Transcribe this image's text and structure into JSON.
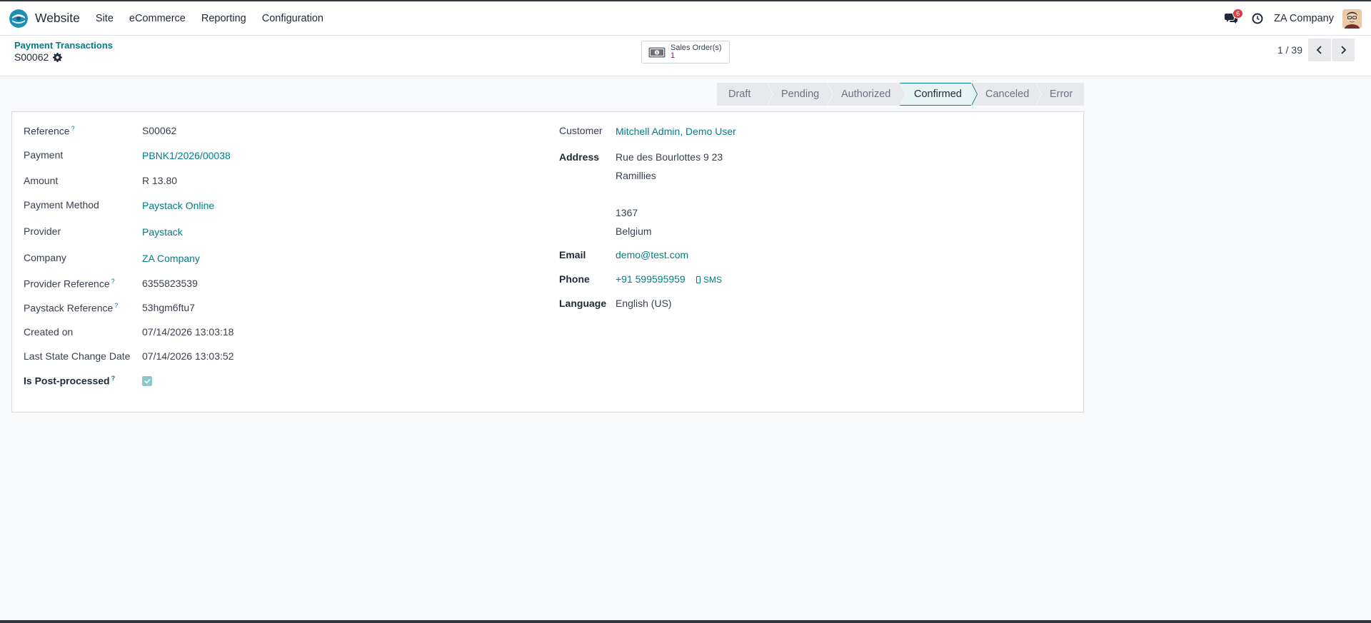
{
  "navbar": {
    "app_name": "Website",
    "menu": [
      "Site",
      "eCommerce",
      "Reporting",
      "Configuration"
    ],
    "message_count": "6",
    "company": "ZA Company"
  },
  "control_panel": {
    "breadcrumb_parent": "Payment Transactions",
    "record_name": "S00062",
    "smart_button": {
      "label": "Sales Order(s)",
      "value": "1"
    },
    "pager": "1 / 39"
  },
  "statusbar": {
    "stages": [
      "Draft",
      "Pending",
      "Authorized",
      "Confirmed",
      "Canceled",
      "Error"
    ],
    "active": "Confirmed"
  },
  "form": {
    "left": {
      "reference": {
        "label": "Reference",
        "value": "S00062"
      },
      "payment": {
        "label": "Payment",
        "value": "PBNK1/2026/00038"
      },
      "amount": {
        "label": "Amount",
        "value": "R 13.80"
      },
      "payment_method": {
        "label": "Payment Method",
        "value": "Paystack Online"
      },
      "provider": {
        "label": "Provider",
        "value": "Paystack"
      },
      "company": {
        "label": "Company",
        "value": "ZA Company"
      },
      "provider_reference": {
        "label": "Provider Reference",
        "value": "6355823539"
      },
      "paystack_reference": {
        "label": "Paystack Reference",
        "value": "53hgm6ftu7"
      },
      "created_on": {
        "label": "Created on",
        "value": "07/14/2026 13:03:18"
      },
      "last_state_change": {
        "label": "Last State Change Date",
        "value": "07/14/2026 13:03:52"
      },
      "is_post_processed": {
        "label": "Is Post-processed",
        "checked": true
      }
    },
    "right": {
      "customer": {
        "label": "Customer",
        "value": "Mitchell Admin, Demo User"
      },
      "address": {
        "label": "Address",
        "street": "Rue des Bourlottes 9 23",
        "city": "Ramillies",
        "zip": "1367",
        "country": "Belgium"
      },
      "email": {
        "label": "Email",
        "value": "demo@test.com"
      },
      "phone": {
        "label": "Phone",
        "value": "+91 599595959",
        "sms_label": "SMS"
      },
      "language": {
        "label": "Language",
        "value": "English (US)"
      }
    },
    "help_marker": "?"
  },
  "colors": {
    "accent": "#017e84",
    "brand_dark": "#2f3540",
    "badge": "#e23b41"
  }
}
